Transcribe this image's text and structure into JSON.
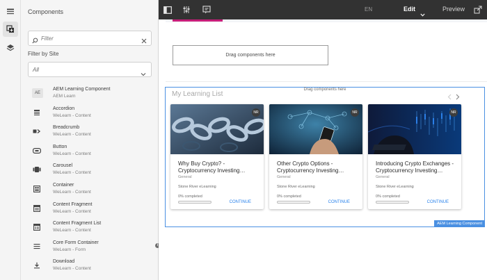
{
  "panel": {
    "title": "Components",
    "filter_placeholder": "Filter",
    "site_label": "Filter by Site",
    "site_value": "All",
    "items": [
      {
        "name": "AEM Learning Component",
        "group": "AEM Learn",
        "icon": "ae-badge-icon",
        "badge": "AE"
      },
      {
        "name": "Accordion",
        "group": "WeLearn - Content",
        "icon": "accordion-icon"
      },
      {
        "name": "Breadcrumb",
        "group": "WeLearn - Content",
        "icon": "breadcrumb-icon"
      },
      {
        "name": "Button",
        "group": "WeLearn - Content",
        "icon": "button-icon"
      },
      {
        "name": "Carousel",
        "group": "WeLearn - Content",
        "icon": "carousel-icon"
      },
      {
        "name": "Container",
        "group": "WeLearn - Content",
        "icon": "container-icon"
      },
      {
        "name": "Content Fragment",
        "group": "WeLearn - Content",
        "icon": "content-fragment-icon"
      },
      {
        "name": "Content Fragment List",
        "group": "WeLearn - Content",
        "icon": "content-fragment-list-icon"
      },
      {
        "name": "Core Form Container",
        "group": "WeLearn - Form",
        "icon": "form-container-icon"
      },
      {
        "name": "Download",
        "group": "WeLearn - Content",
        "icon": "download-icon"
      }
    ]
  },
  "topbar": {
    "language": "EN",
    "mode": "Edit",
    "preview": "Preview"
  },
  "canvas": {
    "drag_placeholder": "Drag components here",
    "component": {
      "title": "My Learning List",
      "drag_placeholder": "Drag components here",
      "tag": "AEM Learning Component",
      "cards": [
        {
          "title": "Why Buy Crypto? - Cryptocurrency Investing…",
          "category": "General",
          "author": "Stone River eLearning",
          "progress_text": "0% completed",
          "progress": 0,
          "cta": "CONTINUE",
          "badge": "NR",
          "image": "chain-image"
        },
        {
          "title": "Other Crypto Options - Cryptocurrency Investing…",
          "category": "General",
          "author": "Stone River eLearning",
          "progress_text": "0% completed",
          "progress": 0,
          "cta": "CONTINUE",
          "badge": "NR",
          "image": "phone-image"
        },
        {
          "title": "Introducing Crypto Exchanges - Cryptocurrency Investing…",
          "category": "General",
          "author": "Stone River eLearning",
          "progress_text": "0% completed",
          "progress": 0,
          "cta": "CONTINUE",
          "badge": "NR",
          "image": "trading-image"
        }
      ]
    }
  },
  "colors": {
    "accent_blue": "#4a90e2",
    "link_blue": "#2680eb",
    "topbar_bg": "#323232",
    "pink_underline": "#c81e79"
  }
}
